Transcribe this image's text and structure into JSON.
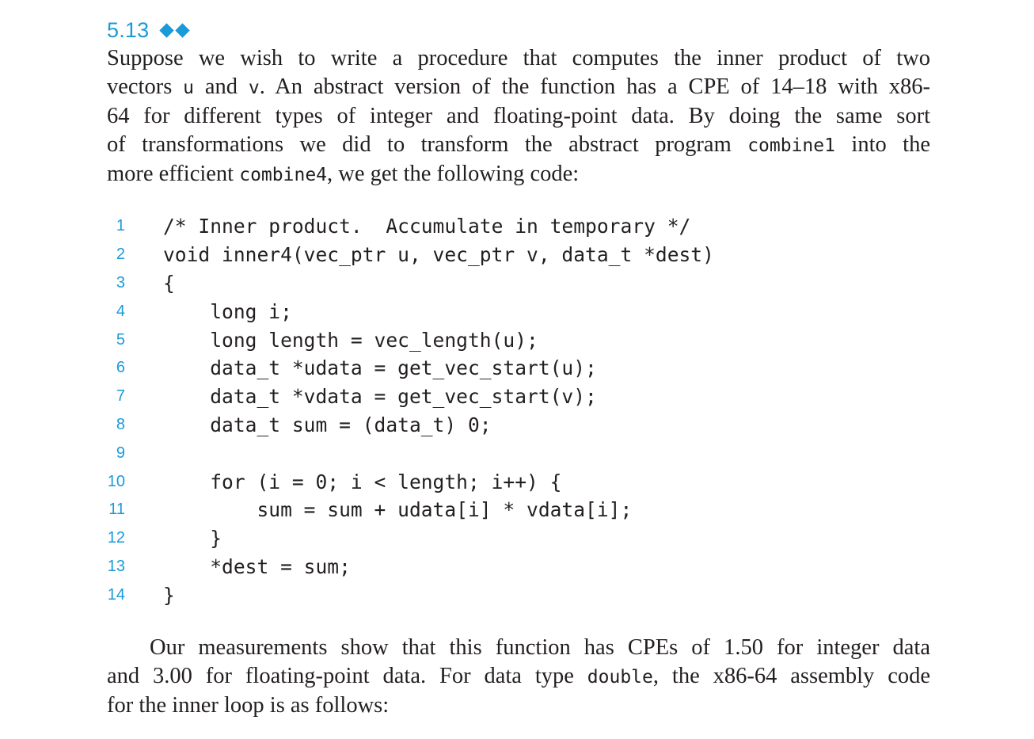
{
  "problem": {
    "number": "5.13",
    "difficulty_icon": "diamond-icon",
    "difficulty_level": 2,
    "accent_color": "#1a9ad9"
  },
  "intro": {
    "l1": "Suppose we wish to write a procedure that computes the inner product of two",
    "l2_a": "vectors ",
    "l2_code_u": "u",
    "l2_b": " and ",
    "l2_code_v": "v",
    "l2_c": ". An abstract version of the function has a CPE of 14–18 with x86-",
    "l3": "64 for different types of integer and floating-point data. By doing the same sort",
    "l4_a": "of transformations we did to transform the abstract program ",
    "l4_code": "combine1",
    "l4_b": " into the",
    "l5_a": "more efficient ",
    "l5_code": "combine4",
    "l5_b": ", we get the following code:"
  },
  "code_listing": [
    {
      "n": "1",
      "text": "/* Inner product.  Accumulate in temporary */"
    },
    {
      "n": "2",
      "text": "void inner4(vec_ptr u, vec_ptr v, data_t *dest)"
    },
    {
      "n": "3",
      "text": "{"
    },
    {
      "n": "4",
      "text": "    long i;"
    },
    {
      "n": "5",
      "text": "    long length = vec_length(u);"
    },
    {
      "n": "6",
      "text": "    data_t *udata = get_vec_start(u);"
    },
    {
      "n": "7",
      "text": "    data_t *vdata = get_vec_start(v);"
    },
    {
      "n": "8",
      "text": "    data_t sum = (data_t) 0;"
    },
    {
      "n": "9",
      "text": ""
    },
    {
      "n": "10",
      "text": "    for (i = 0; i < length; i++) {"
    },
    {
      "n": "11",
      "text": "        sum = sum + udata[i] * vdata[i];"
    },
    {
      "n": "12",
      "text": "    }"
    },
    {
      "n": "13",
      "text": "    *dest = sum;"
    },
    {
      "n": "14",
      "text": "}"
    }
  ],
  "outro": {
    "l1": "Our measurements show that this function has CPEs of 1.50 for integer data",
    "l2_a": "and 3.00 for floating-point data. For data type ",
    "l2_code": "double",
    "l2_b": ", the x86-64 assembly code",
    "l3": "for the inner loop is as follows:"
  }
}
